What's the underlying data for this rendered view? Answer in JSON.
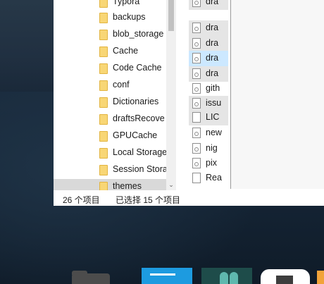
{
  "nav": {
    "items": [
      {
        "label": "Typora",
        "selected": false
      },
      {
        "label": "backups",
        "selected": false
      },
      {
        "label": "blob_storage",
        "selected": false
      },
      {
        "label": "Cache",
        "selected": false
      },
      {
        "label": "Code Cache",
        "selected": false
      },
      {
        "label": "conf",
        "selected": false
      },
      {
        "label": "Dictionaries",
        "selected": false
      },
      {
        "label": "draftsRecove",
        "selected": false
      },
      {
        "label": "GPUCache",
        "selected": false
      },
      {
        "label": "Local Storage",
        "selected": false
      },
      {
        "label": "Session Stora",
        "selected": false
      },
      {
        "label": "themes",
        "selected": true
      }
    ],
    "scroll_down_arrow": "⌄"
  },
  "files": {
    "items": [
      {
        "label": "dra",
        "icon": "gear-file-icon",
        "selected": true
      },
      {
        "label": "dra",
        "icon": "gear-file-icon",
        "selected": true
      },
      {
        "label": "dra",
        "icon": "gear-file-icon",
        "selected": true
      },
      {
        "label": "dra",
        "icon": "gear-file-icon",
        "selected": true,
        "focused": true
      },
      {
        "label": "dra",
        "icon": "gear-file-icon",
        "selected": true
      },
      {
        "label": "gith",
        "icon": "gear-file-icon",
        "selected": false
      },
      {
        "label": "issu",
        "icon": "gear-file-icon",
        "selected": true
      },
      {
        "label": "LIC",
        "icon": "text-file-icon",
        "selected": true
      },
      {
        "label": "new",
        "icon": "gear-file-icon",
        "selected": false
      },
      {
        "label": "nig",
        "icon": "gear-file-icon",
        "selected": false
      },
      {
        "label": "pix",
        "icon": "gear-file-icon",
        "selected": false
      },
      {
        "label": "Rea",
        "icon": "text-file-icon",
        "selected": false
      }
    ]
  },
  "status": {
    "item_count": "26 个项目",
    "selected_count": "已选择 15 个项目"
  },
  "taskbar": {
    "apps": [
      "file-explorer-icon",
      "store-icon",
      "app-icon",
      "typora-icon",
      "app-icon"
    ]
  },
  "colors": {
    "selected_row": "#e5e5e5",
    "focused_row": "#cce8ff",
    "folder": "#f8d675",
    "store_blue": "#1d9be0"
  }
}
